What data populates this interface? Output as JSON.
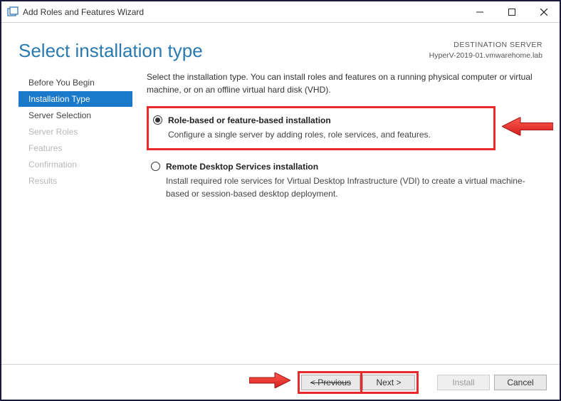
{
  "window": {
    "title": "Add Roles and Features Wizard"
  },
  "header": {
    "title": "Select installation type",
    "destination_label": "DESTINATION SERVER",
    "destination_server": "HyperV-2019-01.vmwarehome.lab"
  },
  "sidebar": {
    "steps": [
      {
        "label": "Before You Begin",
        "state": "normal"
      },
      {
        "label": "Installation Type",
        "state": "active"
      },
      {
        "label": "Server Selection",
        "state": "normal"
      },
      {
        "label": "Server Roles",
        "state": "disabled"
      },
      {
        "label": "Features",
        "state": "disabled"
      },
      {
        "label": "Confirmation",
        "state": "disabled"
      },
      {
        "label": "Results",
        "state": "disabled"
      }
    ]
  },
  "main": {
    "intro": "Select the installation type. You can install roles and features on a running physical computer or virtual machine, or on an offline virtual hard disk (VHD).",
    "options": [
      {
        "title": "Role-based or feature-based installation",
        "desc": "Configure a single server by adding roles, role services, and features.",
        "checked": true,
        "highlighted": true
      },
      {
        "title": "Remote Desktop Services installation",
        "desc": "Install required role services for Virtual Desktop Infrastructure (VDI) to create a virtual machine-based or session-based desktop deployment.",
        "checked": false,
        "highlighted": false
      }
    ]
  },
  "footer": {
    "previous": "< Previous",
    "next": "Next >",
    "install": "Install",
    "cancel": "Cancel"
  }
}
